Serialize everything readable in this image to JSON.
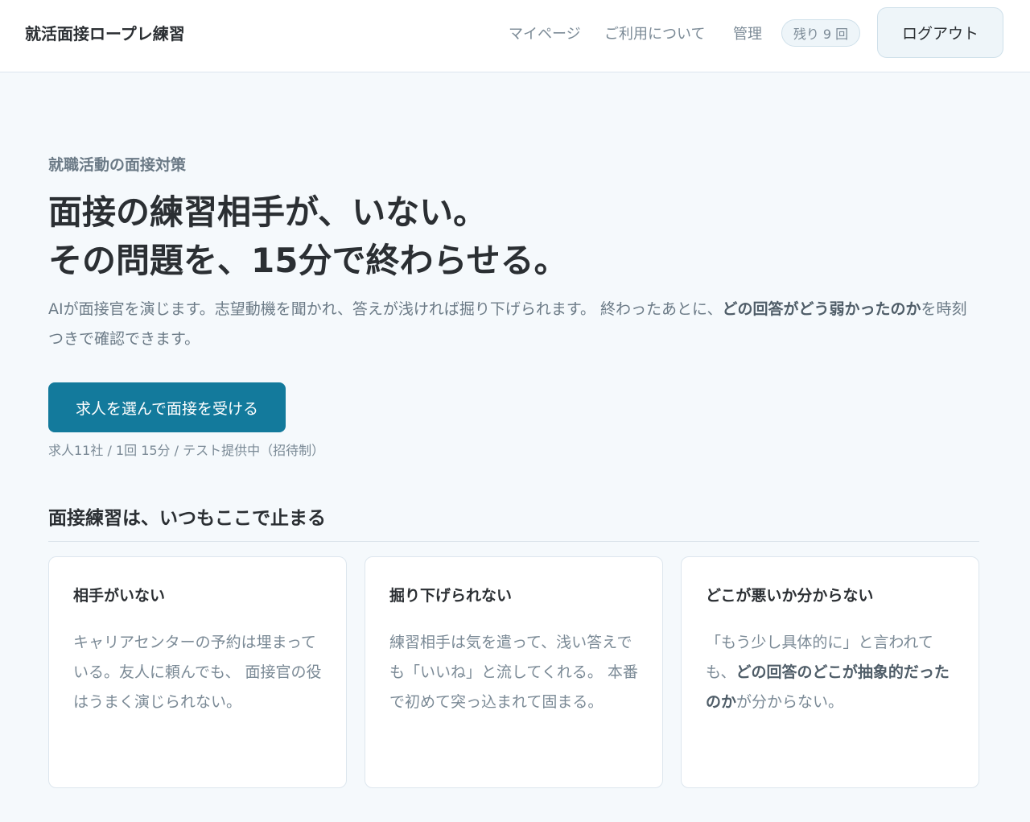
{
  "header": {
    "brand": "就活面接ロープレ練習",
    "nav": [
      "マイページ",
      "ご利用について",
      "管理"
    ],
    "remaining_badge": "残り 9 回",
    "logout_label": "ログアウト"
  },
  "hero": {
    "eyebrow": "就職活動の面接対策",
    "title_line1": "面接の練習相手が、いない。",
    "title_line2": "その問題を、15分で終わらせる。",
    "lead_part1": "AIが面接官を演じます。志望動機を聞かれ、答えが浅ければ掘り下げられます。 終わったあとに、",
    "lead_bold": "どの回答がどう弱かったのか",
    "lead_part2": "を時刻つきで確認できます。",
    "cta_label": "求人を選んで面接を受ける",
    "cta_note": "求人11社 / 1回 15分 / テスト提供中（招待制）"
  },
  "problems": {
    "title": "面接練習は、いつもここで止まる",
    "cards": [
      {
        "title": "相手がいない",
        "body_part1": "キャリアセンターの予約は埋まっている。友人に頼んでも、 面接官の役はうまく演じられない。",
        "body_bold": "",
        "body_part2": ""
      },
      {
        "title": "掘り下げられない",
        "body_part1": "練習相手は気を遣って、浅い答えでも「いいね」と流してくれる。 本番で初めて突っ込まれて固まる。",
        "body_bold": "",
        "body_part2": ""
      },
      {
        "title": "どこが悪いか分からない",
        "body_part1": "「もう少し具体的に」と言われても、",
        "body_bold": "どの回答のどこが抽象的だったのか",
        "body_part2": "が分からない。"
      }
    ]
  },
  "colors": {
    "accent": "#137a9c",
    "background": "#f5f9fc",
    "text": "#2b2f33",
    "muted": "#7b8a96"
  }
}
